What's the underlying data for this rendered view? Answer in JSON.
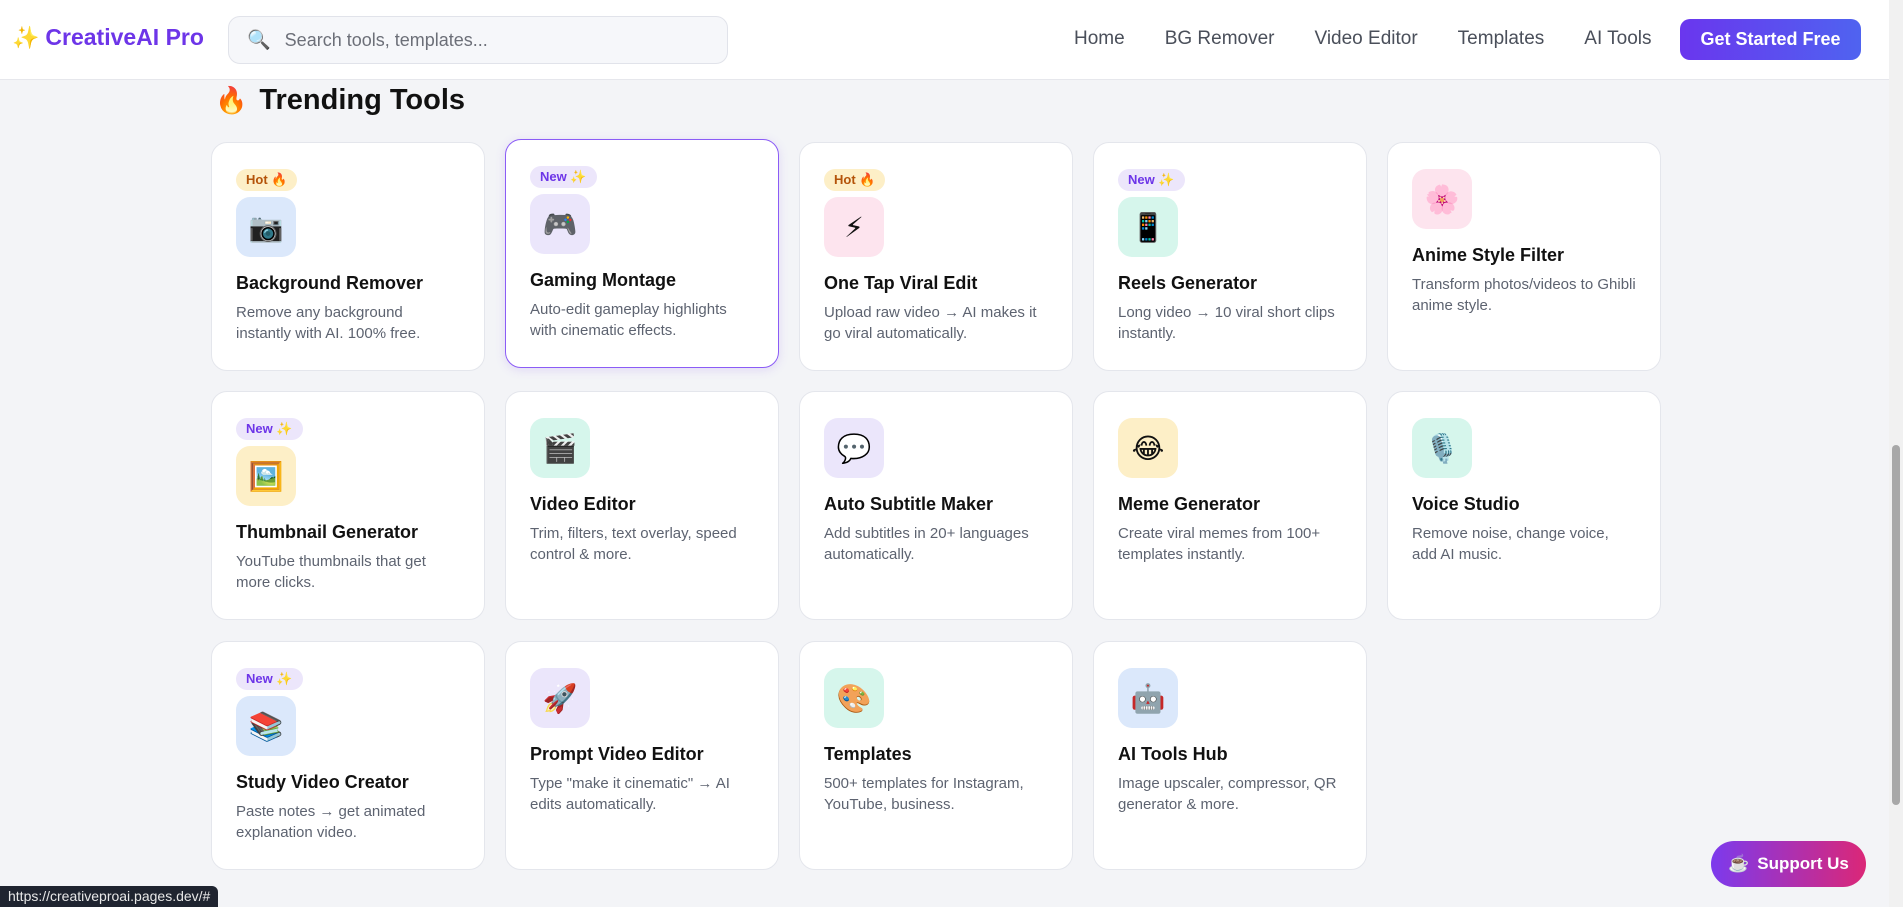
{
  "header": {
    "logo_icon": "sparkles-icon",
    "brand": "CreativeAI Pro",
    "search_placeholder": "Search tools, templates...",
    "nav": [
      "Home",
      "BG Remover",
      "Video Editor",
      "Templates",
      "AI Tools"
    ],
    "cta": "Get Started Free"
  },
  "section": {
    "title": "Trending Tools",
    "icon": "fire-icon"
  },
  "cards": [
    {
      "badge": "Hot 🔥",
      "badge_type": "hot",
      "icon": "📷",
      "icon_name": "camera-icon",
      "tile_color": "#dbe8fb",
      "title": "Background Remover",
      "desc": "Remove any background instantly with AI. 100% free."
    },
    {
      "badge": "New ✨",
      "badge_type": "new",
      "icon": "🎮",
      "icon_name": "gamepad-icon",
      "tile_color": "#ebe6fb",
      "title": "Gaming Montage",
      "desc": "Auto-edit gameplay highlights with cinematic effects."
    },
    {
      "badge": "Hot 🔥",
      "badge_type": "hot",
      "icon": "⚡",
      "icon_name": "lightning-icon",
      "tile_color": "#fde4ee",
      "title": "One Tap Viral Edit",
      "desc": "Upload raw video → AI makes it go viral automatically."
    },
    {
      "badge": "New ✨",
      "badge_type": "new",
      "icon": "📱",
      "icon_name": "phone-icon",
      "tile_color": "#d6f6ec",
      "title": "Reels Generator",
      "desc": "Long video → 10 viral short clips instantly."
    },
    {
      "badge": "",
      "badge_type": "",
      "icon": "🌸",
      "icon_name": "flower-icon",
      "tile_color": "#fde4ee",
      "title": "Anime Style Filter",
      "desc": "Transform photos/videos to Ghibli anime style."
    },
    {
      "badge": "New ✨",
      "badge_type": "new",
      "icon": "🖼️",
      "icon_name": "picture-icon",
      "tile_color": "#fdefc7",
      "title": "Thumbnail Generator",
      "desc": "YouTube thumbnails that get more clicks."
    },
    {
      "badge": "",
      "badge_type": "",
      "icon": "🎬",
      "icon_name": "clapperboard-icon",
      "tile_color": "#d6f6ec",
      "title": "Video Editor",
      "desc": "Trim, filters, text overlay, speed control & more."
    },
    {
      "badge": "",
      "badge_type": "",
      "icon": "💬",
      "icon_name": "speech-bubble-icon",
      "tile_color": "#ebe6fb",
      "title": "Auto Subtitle Maker",
      "desc": "Add subtitles in 20+ languages automatically."
    },
    {
      "badge": "",
      "badge_type": "",
      "icon": "😂",
      "icon_name": "laughing-face-icon",
      "tile_color": "#fdefc7",
      "title": "Meme Generator",
      "desc": "Create viral memes from 100+ templates instantly."
    },
    {
      "badge": "",
      "badge_type": "",
      "icon": "🎙️",
      "icon_name": "microphone-icon",
      "tile_color": "#d6f6ec",
      "title": "Voice Studio",
      "desc": "Remove noise, change voice, add AI music."
    },
    {
      "badge": "New ✨",
      "badge_type": "new",
      "icon": "📚",
      "icon_name": "books-icon",
      "tile_color": "#dbe8fb",
      "title": "Study Video Creator",
      "desc": "Paste notes → get animated explanation video."
    },
    {
      "badge": "",
      "badge_type": "",
      "icon": "🚀",
      "icon_name": "rocket-icon",
      "tile_color": "#ebe6fb",
      "title": "Prompt Video Editor",
      "desc": "Type \"make it cinematic\" → AI edits automatically."
    },
    {
      "badge": "",
      "badge_type": "",
      "icon": "🎨",
      "icon_name": "palette-icon",
      "tile_color": "#d6f6ec",
      "title": "Templates",
      "desc": "500+ templates for Instagram, YouTube, business."
    },
    {
      "badge": "",
      "badge_type": "",
      "icon": "🤖",
      "icon_name": "robot-icon",
      "tile_color": "#dbe8fb",
      "title": "AI Tools Hub",
      "desc": "Image upscaler, compressor, QR generator & more."
    }
  ],
  "support": {
    "label": "Support Us",
    "icon": "☕"
  },
  "status_url": "https://creativeproai.pages.dev/#"
}
